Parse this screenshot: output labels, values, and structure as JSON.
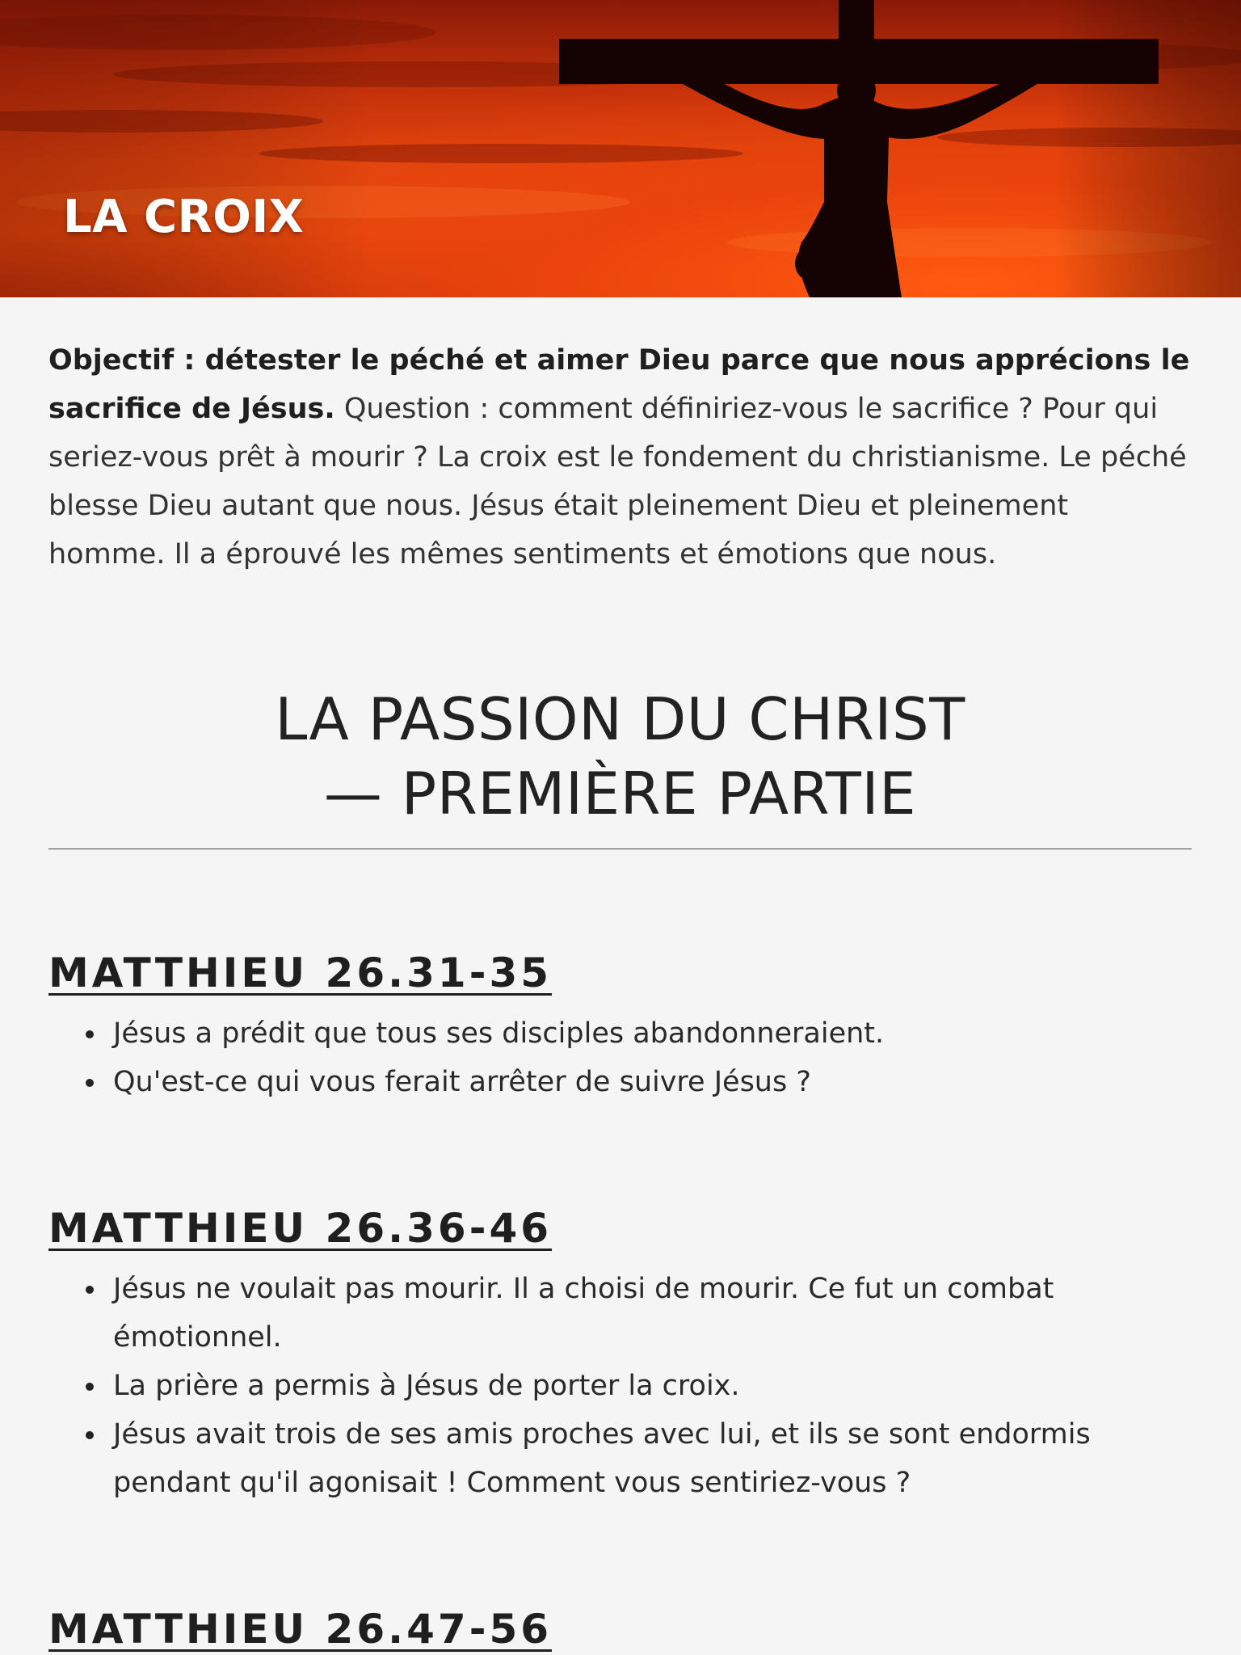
{
  "header": {
    "title": "LA CROIX",
    "image_icon": "crucifix-silhouette-image"
  },
  "intro": {
    "bold": "Objectif : détester le péché et aimer Dieu parce que nous apprécions le sacrifice de Jésus.",
    "text": " Question : comment définiriez-vous le sacrifice ? Pour qui seriez-vous prêt à mourir ? La croix est le fondement du christianisme. Le péché blesse Dieu autant que nous. Jésus était pleinement Dieu et pleinement homme. Il a éprouvé les mêmes sentiments et émotions que nous."
  },
  "section": {
    "title_line1": "LA PASSION DU CHRIST",
    "title_line2": "— PREMIÈRE PARTIE"
  },
  "passages": [
    {
      "reference": "MATTHIEU 26.31-35",
      "points": [
        "Jésus a prédit que tous ses disciples abandonneraient.",
        "Qu'est-ce qui vous ferait arrêter de suivre Jésus ?"
      ]
    },
    {
      "reference": "MATTHIEU 26.36-46",
      "points": [
        "Jésus ne voulait pas mourir. Il a choisi de mourir. Ce fut un combat émotionnel.",
        "La prière a permis à Jésus de porter la croix.",
        "Jésus avait trois de ses amis proches avec lui, et ils se sont endormis pendant qu'il agonisait ! Comment vous sentiriez-vous ?"
      ]
    },
    {
      "reference": "MATTHIEU 26.47-56",
      "points": []
    }
  ]
}
